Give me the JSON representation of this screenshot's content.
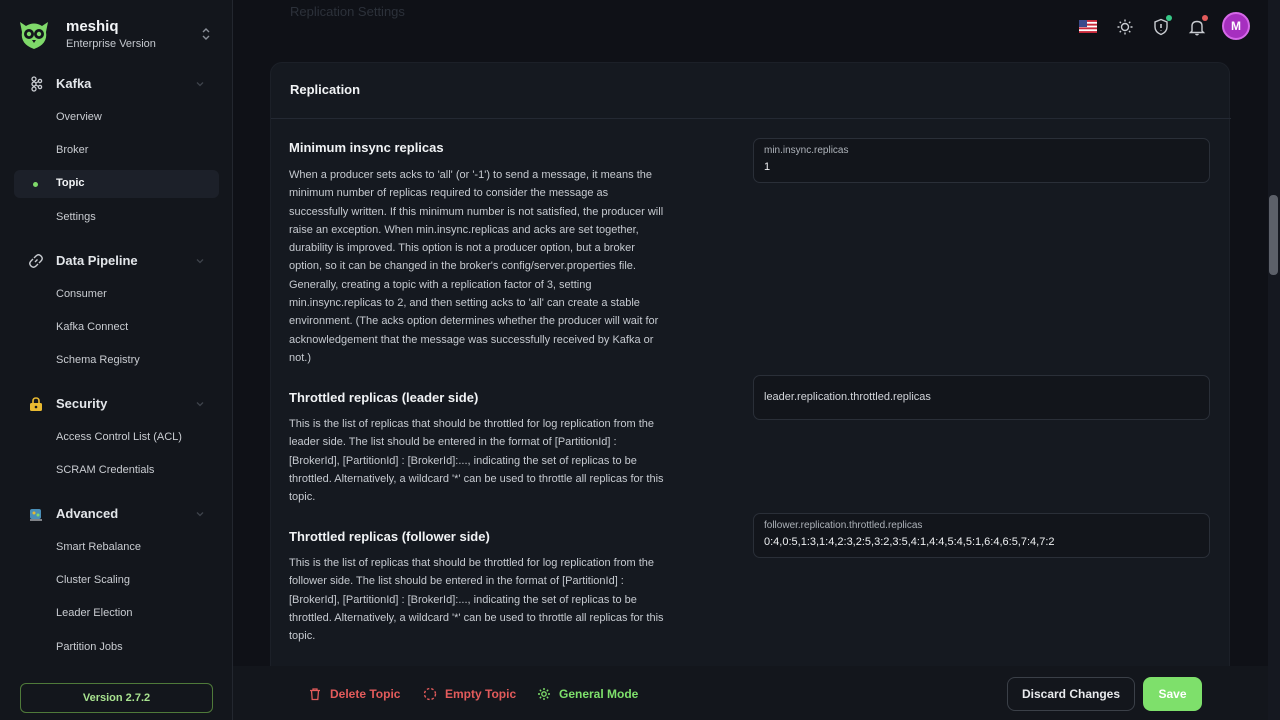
{
  "brand": {
    "name": "meshiq",
    "subtitle": "Enterprise Version"
  },
  "sidebar": {
    "groups": [
      {
        "label": "Kafka",
        "items": [
          "Overview",
          "Broker",
          "Topic",
          "Settings"
        ]
      },
      {
        "label": "Data Pipeline",
        "items": [
          "Consumer",
          "Kafka Connect",
          "Schema Registry"
        ]
      },
      {
        "label": "Security",
        "items": [
          "Access Control List (ACL)",
          "SCRAM Credentials"
        ]
      },
      {
        "label": "Advanced",
        "items": [
          "Smart Rebalance",
          "Cluster Scaling",
          "Leader Election",
          "Partition Jobs"
        ]
      }
    ],
    "active_item": "Topic",
    "version": "Version 2.7.2"
  },
  "topbar": {
    "avatar_initial": "M",
    "icons": [
      "us-flag-icon",
      "sun-icon",
      "shield-icon",
      "bell-icon"
    ]
  },
  "faded_heading": "Replication Settings",
  "card": {
    "title": "Replication",
    "sections": [
      {
        "title": "Minimum insync replicas",
        "description": "When a producer sets acks to 'all' (or '-1') to send a message, it means the minimum number of replicas required to consider the message as successfully written. If this minimum number is not satisfied, the producer will raise an exception. When min.insync.replicas and acks are set together, durability is improved. This option is not a producer option, but a broker option, so it can be changed in the broker's config/server.properties file. Generally, creating a topic with a replication factor of 3, setting min.insync.replicas to 2, and then setting acks to 'all' can create a stable environment. (The acks option determines whether the producer will wait for acknowledgement that the message was successfully received by Kafka or not.)",
        "field_label": "min.insync.replicas",
        "field_value": "1"
      },
      {
        "title": "Throttled replicas (leader side)",
        "description": "This is the list of replicas that should be throttled for log replication from the leader side. The list should be entered in the format of [PartitionId] : [BrokerId], [PartitionId] : [BrokerId]:..., indicating the set of replicas to be throttled. Alternatively, a wildcard '*' can be used to throttle all replicas for this topic.",
        "field_placeholder": "leader.replication.throttled.replicas"
      },
      {
        "title": "Throttled replicas (follower side)",
        "description": "This is the list of replicas that should be throttled for log replication from the follower side. The list should be entered in the format of [PartitionId] : [BrokerId], [PartitionId] : [BrokerId]:..., indicating the set of replicas to be throttled. Alternatively, a wildcard '*' can be used to throttle all replicas for this topic.",
        "field_label": "follower.replication.throttled.replicas",
        "field_value": "0:4,0:5,1:3,1:4,2:3,2:5,3:2,3:5,4:1,4:4,5:4,5:1,6:4,6:5,7:4,7:2"
      }
    ]
  },
  "bottom_bar": {
    "delete_label": "Delete Topic",
    "empty_label": "Empty Topic",
    "mode_label": "General Mode",
    "discard_label": "Discard Changes",
    "save_label": "Save"
  },
  "colors": {
    "accent": "#7ee06b",
    "danger": "#e35b5b",
    "avatar": "#a62fbf"
  }
}
